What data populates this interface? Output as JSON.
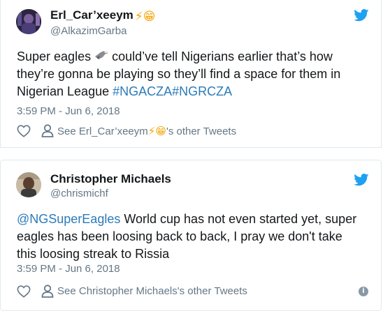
{
  "tweets": [
    {
      "author_name": "Erl_Car’xeeym",
      "author_emojis": "⚡😁",
      "handle": "@AlkazimGarba",
      "text_part1": "Super eagles ",
      "text_part2": " could’ve tell Nigerians earlier that’s how they’re gonna be playing so they’ll find a space for them in Nigerian League ",
      "hashtag1": "#NGACZA",
      "hashtag2": "#NGRCZA",
      "date": "3:59 PM - Jun 6, 2018",
      "other_tweets_prefix": "See Erl_Car’xeeym",
      "other_tweets_suffix": "'s other Tweets"
    },
    {
      "author_name": "Christopher Michaels",
      "handle": "@chrismichf",
      "mention": "@NGSuperEagles",
      "text": " World cup has not even started yet, super eagles has been loosing back to back, I pray we don't take this loosing streak to Rissia",
      "date": "3:59 PM - Jun 6, 2018",
      "other_tweets": "See Christopher Michaels's other Tweets",
      "info_glyph": "i"
    }
  ],
  "colors": {
    "twitter_blue": "#1da1f2",
    "link": "#2b7bb9",
    "secondary_text": "#657786",
    "border": "#e1e8ed"
  },
  "icons": [
    "avatar",
    "twitter-bird-icon",
    "eagle-emoji-icon",
    "heart-icon",
    "person-icon",
    "info-icon"
  ]
}
